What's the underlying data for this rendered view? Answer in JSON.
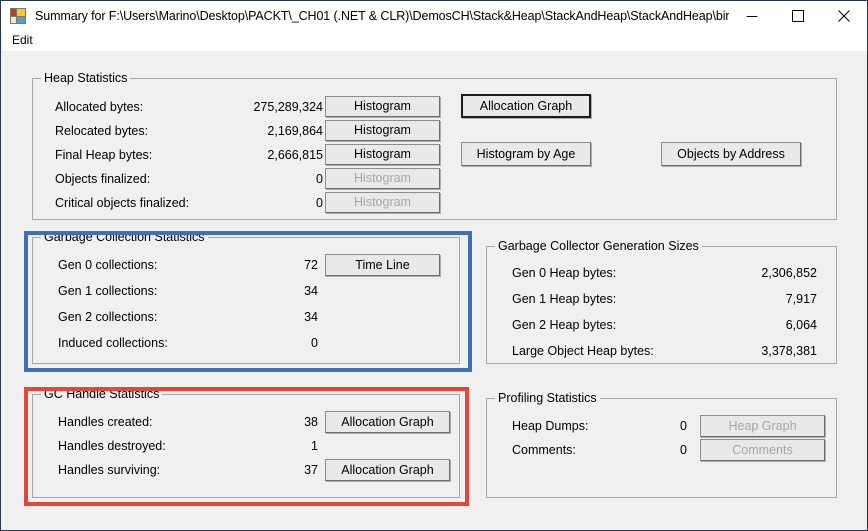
{
  "window": {
    "title": "Summary for F:\\Users\\Marino\\Desktop\\PACKT\\_CH01 (.NET & CLR)\\DemosCH\\Stack&Heap\\StackAndHeap\\StackAndHeap\\bin\\...",
    "icon": "app-windows-forms-icon",
    "controls": {
      "minimize": "minimize-icon",
      "maximize": "maximize-icon",
      "close": "close-icon"
    }
  },
  "menu": {
    "items": [
      {
        "label": "Edit"
      }
    ]
  },
  "heap_statistics": {
    "title": "Heap Statistics",
    "rows": [
      {
        "label": "Allocated bytes:",
        "value": "275,289,324",
        "button": "Histogram",
        "enabled": true
      },
      {
        "label": "Relocated bytes:",
        "value": "2,169,864",
        "button": "Histogram",
        "enabled": true
      },
      {
        "label": "Final Heap bytes:",
        "value": "2,666,815",
        "button": "Histogram",
        "enabled": true
      },
      {
        "label": "Objects finalized:",
        "value": "0",
        "button": "Histogram",
        "enabled": false
      },
      {
        "label": "Critical objects finalized:",
        "value": "0",
        "button": "Histogram",
        "enabled": false
      }
    ],
    "extra_buttons": [
      {
        "label": "Allocation Graph",
        "enabled": true,
        "focused": true
      },
      {
        "label": "Histogram by Age",
        "enabled": true,
        "focused": false
      },
      {
        "label": "Objects by Address",
        "enabled": true,
        "focused": false
      }
    ]
  },
  "gc_statistics": {
    "title": "Garbage Collection Statistics",
    "rows": [
      {
        "label": "Gen 0 collections:",
        "value": "72"
      },
      {
        "label": "Gen 1 collections:",
        "value": "34"
      },
      {
        "label": "Gen 2 collections:",
        "value": "34"
      },
      {
        "label": "Induced collections:",
        "value": "0"
      }
    ],
    "buttons": [
      {
        "label": "Time Line",
        "enabled": true
      }
    ],
    "highlight_color": "#3f6fb5"
  },
  "gc_generation_sizes": {
    "title": "Garbage Collector Generation Sizes",
    "rows": [
      {
        "label": "Gen 0 Heap bytes:",
        "value": "2,306,852"
      },
      {
        "label": "Gen 1 Heap bytes:",
        "value": "7,917"
      },
      {
        "label": "Gen 2 Heap bytes:",
        "value": "6,064"
      },
      {
        "label": "Large Object Heap bytes:",
        "value": "3,378,381"
      }
    ]
  },
  "gc_handle_statistics": {
    "title": "GC Handle Statistics",
    "rows": [
      {
        "label": "Handles created:",
        "value": "38",
        "button": "Allocation Graph",
        "enabled": true
      },
      {
        "label": "Handles destroyed:",
        "value": "1",
        "button": "",
        "enabled": true
      },
      {
        "label": "Handles surviving:",
        "value": "37",
        "button": "Allocation Graph",
        "enabled": true
      }
    ],
    "highlight_color": "#e0483a"
  },
  "profiling_statistics": {
    "title": "Profiling Statistics",
    "rows": [
      {
        "label": "Heap Dumps:",
        "value": "0",
        "button": "Heap Graph",
        "enabled": false
      },
      {
        "label": "Comments:",
        "value": "0",
        "button": "Comments",
        "enabled": false
      }
    ]
  }
}
